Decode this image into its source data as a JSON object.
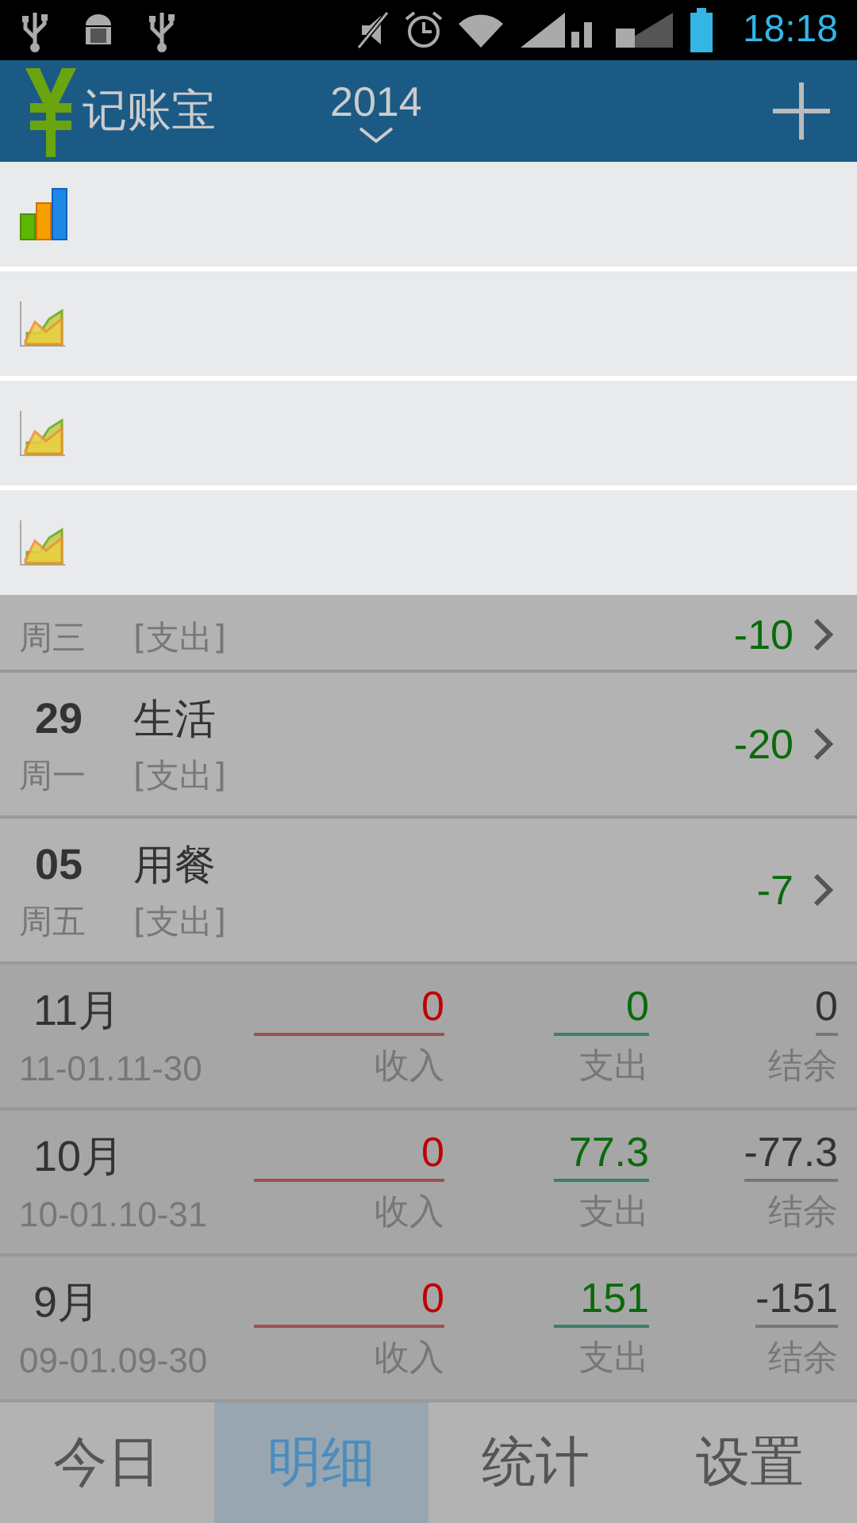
{
  "status_bar": {
    "time": "18:18"
  },
  "header": {
    "title": "记账宝",
    "year": "2014"
  },
  "menu": {
    "items": [
      {
        "kind": "bar"
      },
      {
        "kind": "area"
      },
      {
        "kind": "area"
      },
      {
        "kind": "area"
      }
    ]
  },
  "entries": [
    {
      "weekday": "周三",
      "type": "[支出]",
      "amount": "-10"
    },
    {
      "day": "29",
      "category": "生活",
      "weekday": "周一",
      "type": "[支出]",
      "amount": "-20"
    },
    {
      "day": "05",
      "category": "用餐",
      "weekday": "周五",
      "type": "[支出]",
      "amount": "-7"
    }
  ],
  "months": [
    {
      "month": "11月",
      "range": "11-01.11-30",
      "income": "0",
      "income_label": "收入",
      "expense": "0",
      "expense_label": "支出",
      "balance": "0",
      "balance_label": "结余"
    },
    {
      "month": "10月",
      "range": "10-01.10-31",
      "income": "0",
      "income_label": "收入",
      "expense": "77.3",
      "expense_label": "支出",
      "balance": "-77.3",
      "balance_label": "结余"
    },
    {
      "month": "9月",
      "range": "09-01.09-30",
      "income": "0",
      "income_label": "收入",
      "expense": "151",
      "expense_label": "支出",
      "balance": "-151",
      "balance_label": "结余"
    }
  ],
  "tabs": [
    {
      "label": "今日",
      "selected": false
    },
    {
      "label": "明细",
      "selected": true
    },
    {
      "label": "统计",
      "selected": false
    },
    {
      "label": "设置",
      "selected": false
    }
  ]
}
